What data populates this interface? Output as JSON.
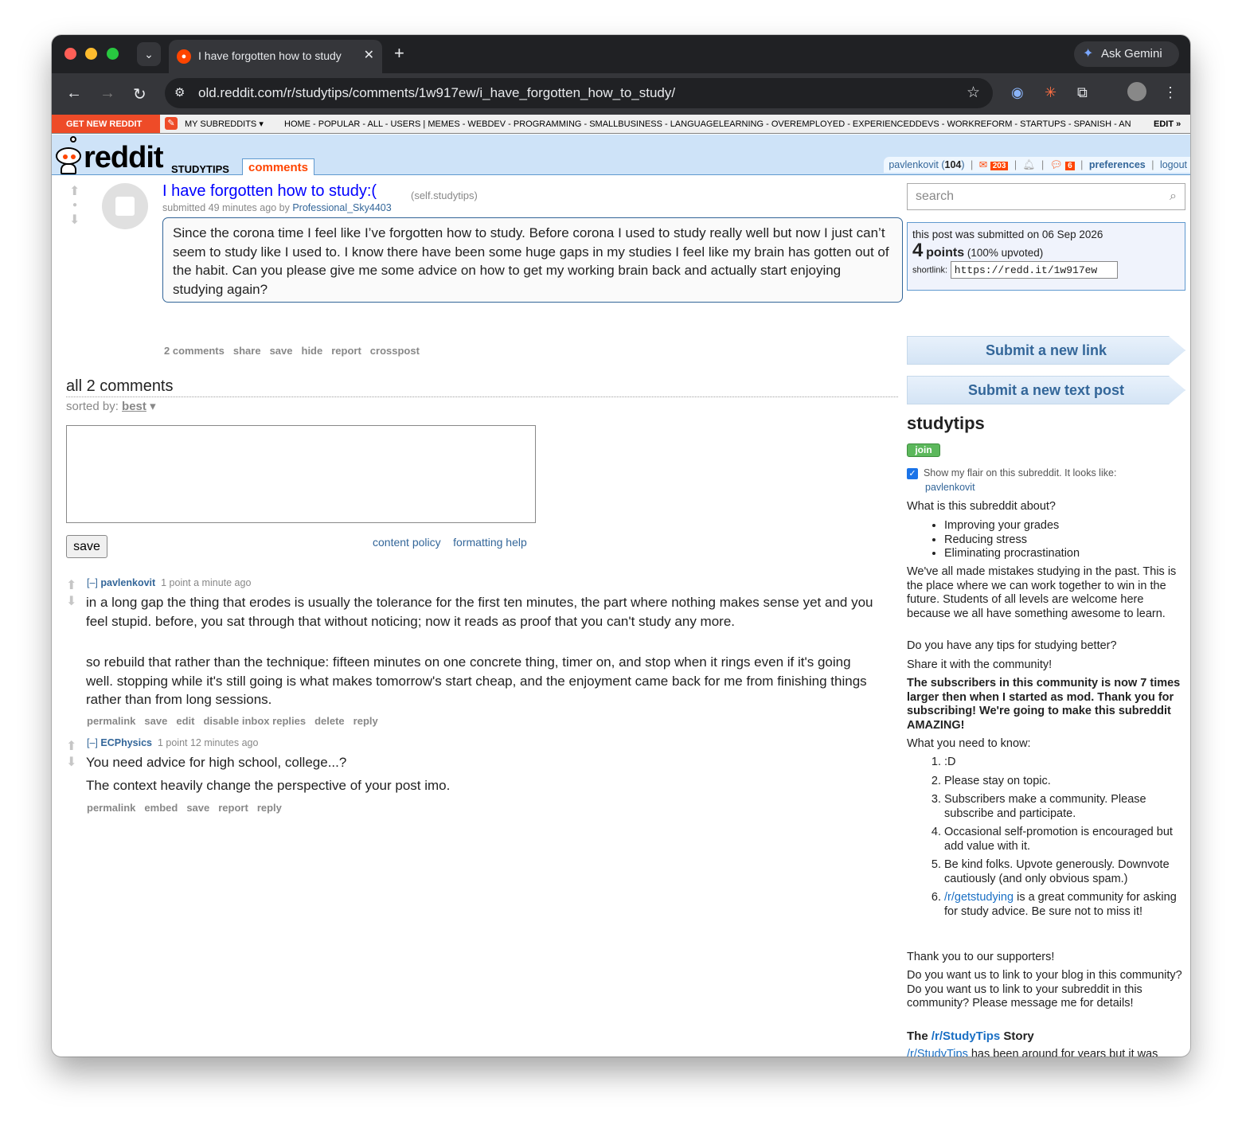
{
  "browser": {
    "tab_title": "I have forgotten how to study",
    "url": "old.reddit.com/r/studytips/comments/1w917ew/i_have_forgotten_how_to_study/",
    "gemini_label": "Ask Gemini"
  },
  "srbar": {
    "get_new": "GET NEW REDDIT",
    "my_subreddits": "MY SUBREDDITS",
    "links": "HOME - POPULAR - ALL - USERS  |  MEMES - WEBDEV - PROGRAMMING - SMALLBUSINESS - LANGUAGELEARNING - OVEREMPLOYED - EXPERIENCEDDEVS - WORKREFORM - STARTUPS - SPANISH - AN",
    "edit": "EDIT »"
  },
  "header": {
    "logo": "reddit",
    "pagename": "STUDYTIPS",
    "tab": "comments",
    "user": "pavlenkovit",
    "karma": "104",
    "mail_count": "203",
    "chat_count": "6",
    "preferences": "preferences",
    "logout": "logout"
  },
  "post": {
    "title": "I have forgotten how to study:(",
    "domain": "(self.studytips)",
    "submitted": "submitted 49 minutes ago by",
    "author": "Professional_Sky4403",
    "selftext": "Since the corona time I feel like I’ve forgotten how to study. Before corona I used to study really well but now I just can’t seem to study like I used to. I know there have been some huge gaps in my studies I feel like my brain has gotten out of the habit. Can you please give me some advice on how to get my working brain back and actually start enjoying studying again?",
    "buttons": [
      "2 comments",
      "share",
      "save",
      "hide",
      "report",
      "crosspost"
    ]
  },
  "comments_area": {
    "heading": "all 2 comments",
    "sorted_by_label": "sorted by:",
    "sorted_by_value": "best",
    "save_label": "save",
    "content_policy": "content policy",
    "formatting_help": "formatting help"
  },
  "comments": [
    {
      "toggle": "[–]",
      "author": "pavlenkovit",
      "meta": "1 point a minute ago",
      "paragraphs": [
        "in a long gap the thing that erodes is usually the tolerance for the first ten minutes, the part where nothing makes sense yet and you feel stupid. before, you sat through that without noticing; now it reads as proof that you can't study any more.",
        "so rebuild that rather than the technique: fifteen minutes on one concrete thing, timer on, and stop when it rings even if it's going well. stopping while it's still going is what makes tomorrow's start cheap, and the enjoyment came back for me from finishing things rather than from long sessions."
      ],
      "buttons": [
        "permalink",
        "save",
        "edit",
        "disable inbox replies",
        "delete",
        "reply"
      ]
    },
    {
      "toggle": "[–]",
      "author": "ECPhysics",
      "meta": "1 point 12 minutes ago",
      "paragraphs": [
        "You need advice for high school, college...?",
        "The context heavily change the perspective of your post imo."
      ],
      "buttons": [
        "permalink",
        "embed",
        "save",
        "report",
        "reply"
      ]
    }
  ],
  "sidebar": {
    "search_placeholder": "search",
    "submitted_on": "this post was submitted on 06 Sep 2026",
    "points": "4",
    "points_label": "points",
    "upvoted": "(100% upvoted)",
    "shortlink_label": "shortlink:",
    "shortlink": "https://redd.it/1w917ew",
    "submit_link": "Submit a new link",
    "submit_text": "Submit a new text post",
    "sr_name": "studytips",
    "join": "join",
    "flair_text": "Show my flair on this subreddit. It looks like:",
    "flair_user": "pavlenkovit",
    "about_heading": "What is this subreddit about?",
    "about_items": [
      "Improving your grades",
      "Reducing stress",
      "Eliminating procrastination"
    ],
    "intro": "We've all made mistakes studying in the past. This is the place where we can work together to win in the future. Students of all levels are welcome here because we all have something awesome to learn.",
    "tips_q": "Do you have any tips for studying better?",
    "share": "Share it with the community!",
    "bold_note": "The subscribers in this community is now 7 times larger then when I started as mod. Thank you for subscribing! We're going to make this subreddit AMAZING!",
    "need_to_know": "What you need to know:",
    "rules": [
      ":D",
      "Please stay on topic.",
      "Subscribers make a community. Please subscribe and participate.",
      "Occasional self-promotion is encouraged but add value with it.",
      "Be kind folks. Upvote generously. Downvote cautiously (and only obvious spam.)"
    ],
    "rule6_link": "/r/getstudying",
    "rule6_rest": " is a great community for asking for study advice. Be sure not to miss it!",
    "thanks": "Thank you to our supporters!",
    "blog_q": "Do you want us to link to your blog in this community? Do you want us to link to your subreddit in this community? Please message me for details!",
    "story_pre": "The ",
    "story_link": "/r/StudyTips",
    "story_post": " Story",
    "story_text_link": "/r/StudyTips",
    "story_text": " has been around for years but it was obscure and poorly moderated. I recently adopted this subreddit to pull it out from"
  }
}
